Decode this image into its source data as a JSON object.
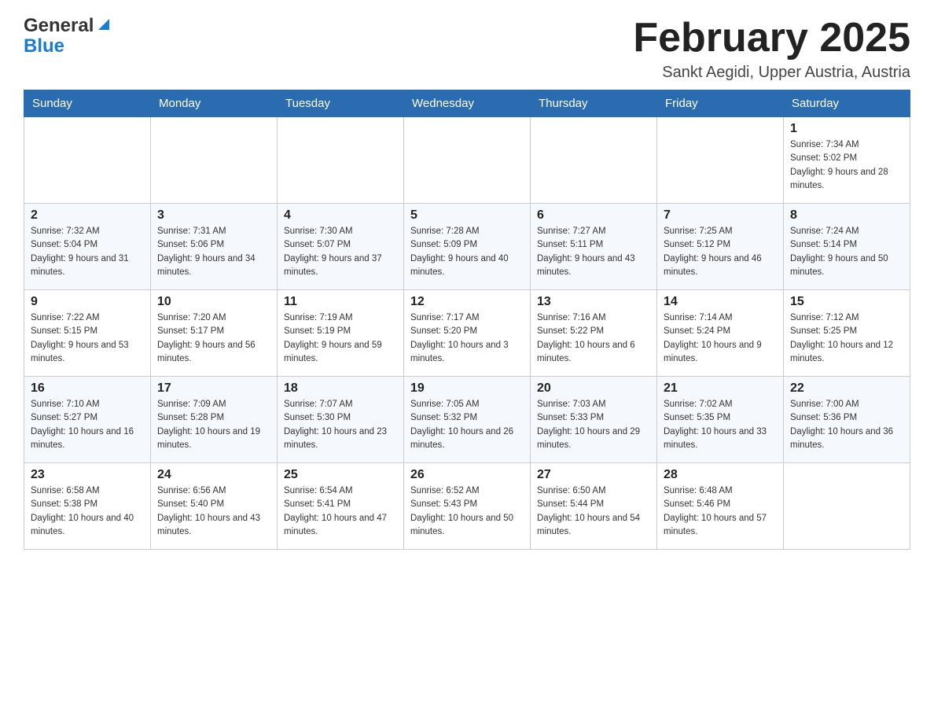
{
  "header": {
    "logo_general": "General",
    "logo_blue": "Blue",
    "month_title": "February 2025",
    "location": "Sankt Aegidi, Upper Austria, Austria"
  },
  "days_of_week": [
    "Sunday",
    "Monday",
    "Tuesday",
    "Wednesday",
    "Thursday",
    "Friday",
    "Saturday"
  ],
  "weeks": [
    [
      {
        "day": "",
        "sunrise": "",
        "sunset": "",
        "daylight": ""
      },
      {
        "day": "",
        "sunrise": "",
        "sunset": "",
        "daylight": ""
      },
      {
        "day": "",
        "sunrise": "",
        "sunset": "",
        "daylight": ""
      },
      {
        "day": "",
        "sunrise": "",
        "sunset": "",
        "daylight": ""
      },
      {
        "day": "",
        "sunrise": "",
        "sunset": "",
        "daylight": ""
      },
      {
        "day": "",
        "sunrise": "",
        "sunset": "",
        "daylight": ""
      },
      {
        "day": "1",
        "sunrise": "Sunrise: 7:34 AM",
        "sunset": "Sunset: 5:02 PM",
        "daylight": "Daylight: 9 hours and 28 minutes."
      }
    ],
    [
      {
        "day": "2",
        "sunrise": "Sunrise: 7:32 AM",
        "sunset": "Sunset: 5:04 PM",
        "daylight": "Daylight: 9 hours and 31 minutes."
      },
      {
        "day": "3",
        "sunrise": "Sunrise: 7:31 AM",
        "sunset": "Sunset: 5:06 PM",
        "daylight": "Daylight: 9 hours and 34 minutes."
      },
      {
        "day": "4",
        "sunrise": "Sunrise: 7:30 AM",
        "sunset": "Sunset: 5:07 PM",
        "daylight": "Daylight: 9 hours and 37 minutes."
      },
      {
        "day": "5",
        "sunrise": "Sunrise: 7:28 AM",
        "sunset": "Sunset: 5:09 PM",
        "daylight": "Daylight: 9 hours and 40 minutes."
      },
      {
        "day": "6",
        "sunrise": "Sunrise: 7:27 AM",
        "sunset": "Sunset: 5:11 PM",
        "daylight": "Daylight: 9 hours and 43 minutes."
      },
      {
        "day": "7",
        "sunrise": "Sunrise: 7:25 AM",
        "sunset": "Sunset: 5:12 PM",
        "daylight": "Daylight: 9 hours and 46 minutes."
      },
      {
        "day": "8",
        "sunrise": "Sunrise: 7:24 AM",
        "sunset": "Sunset: 5:14 PM",
        "daylight": "Daylight: 9 hours and 50 minutes."
      }
    ],
    [
      {
        "day": "9",
        "sunrise": "Sunrise: 7:22 AM",
        "sunset": "Sunset: 5:15 PM",
        "daylight": "Daylight: 9 hours and 53 minutes."
      },
      {
        "day": "10",
        "sunrise": "Sunrise: 7:20 AM",
        "sunset": "Sunset: 5:17 PM",
        "daylight": "Daylight: 9 hours and 56 minutes."
      },
      {
        "day": "11",
        "sunrise": "Sunrise: 7:19 AM",
        "sunset": "Sunset: 5:19 PM",
        "daylight": "Daylight: 9 hours and 59 minutes."
      },
      {
        "day": "12",
        "sunrise": "Sunrise: 7:17 AM",
        "sunset": "Sunset: 5:20 PM",
        "daylight": "Daylight: 10 hours and 3 minutes."
      },
      {
        "day": "13",
        "sunrise": "Sunrise: 7:16 AM",
        "sunset": "Sunset: 5:22 PM",
        "daylight": "Daylight: 10 hours and 6 minutes."
      },
      {
        "day": "14",
        "sunrise": "Sunrise: 7:14 AM",
        "sunset": "Sunset: 5:24 PM",
        "daylight": "Daylight: 10 hours and 9 minutes."
      },
      {
        "day": "15",
        "sunrise": "Sunrise: 7:12 AM",
        "sunset": "Sunset: 5:25 PM",
        "daylight": "Daylight: 10 hours and 12 minutes."
      }
    ],
    [
      {
        "day": "16",
        "sunrise": "Sunrise: 7:10 AM",
        "sunset": "Sunset: 5:27 PM",
        "daylight": "Daylight: 10 hours and 16 minutes."
      },
      {
        "day": "17",
        "sunrise": "Sunrise: 7:09 AM",
        "sunset": "Sunset: 5:28 PM",
        "daylight": "Daylight: 10 hours and 19 minutes."
      },
      {
        "day": "18",
        "sunrise": "Sunrise: 7:07 AM",
        "sunset": "Sunset: 5:30 PM",
        "daylight": "Daylight: 10 hours and 23 minutes."
      },
      {
        "day": "19",
        "sunrise": "Sunrise: 7:05 AM",
        "sunset": "Sunset: 5:32 PM",
        "daylight": "Daylight: 10 hours and 26 minutes."
      },
      {
        "day": "20",
        "sunrise": "Sunrise: 7:03 AM",
        "sunset": "Sunset: 5:33 PM",
        "daylight": "Daylight: 10 hours and 29 minutes."
      },
      {
        "day": "21",
        "sunrise": "Sunrise: 7:02 AM",
        "sunset": "Sunset: 5:35 PM",
        "daylight": "Daylight: 10 hours and 33 minutes."
      },
      {
        "day": "22",
        "sunrise": "Sunrise: 7:00 AM",
        "sunset": "Sunset: 5:36 PM",
        "daylight": "Daylight: 10 hours and 36 minutes."
      }
    ],
    [
      {
        "day": "23",
        "sunrise": "Sunrise: 6:58 AM",
        "sunset": "Sunset: 5:38 PM",
        "daylight": "Daylight: 10 hours and 40 minutes."
      },
      {
        "day": "24",
        "sunrise": "Sunrise: 6:56 AM",
        "sunset": "Sunset: 5:40 PM",
        "daylight": "Daylight: 10 hours and 43 minutes."
      },
      {
        "day": "25",
        "sunrise": "Sunrise: 6:54 AM",
        "sunset": "Sunset: 5:41 PM",
        "daylight": "Daylight: 10 hours and 47 minutes."
      },
      {
        "day": "26",
        "sunrise": "Sunrise: 6:52 AM",
        "sunset": "Sunset: 5:43 PM",
        "daylight": "Daylight: 10 hours and 50 minutes."
      },
      {
        "day": "27",
        "sunrise": "Sunrise: 6:50 AM",
        "sunset": "Sunset: 5:44 PM",
        "daylight": "Daylight: 10 hours and 54 minutes."
      },
      {
        "day": "28",
        "sunrise": "Sunrise: 6:48 AM",
        "sunset": "Sunset: 5:46 PM",
        "daylight": "Daylight: 10 hours and 57 minutes."
      },
      {
        "day": "",
        "sunrise": "",
        "sunset": "",
        "daylight": ""
      }
    ]
  ]
}
